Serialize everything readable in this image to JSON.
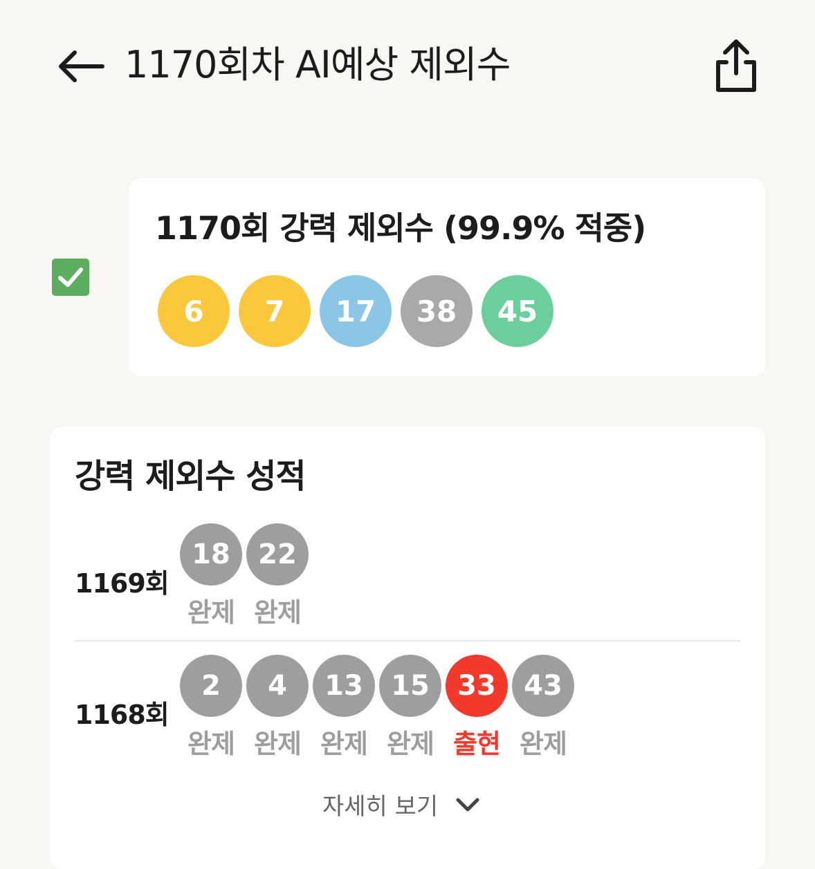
{
  "header": {
    "title": "1170회차 AI예상 제외수",
    "back_icon": "arrow-left-icon",
    "share_icon": "share-icon"
  },
  "prediction": {
    "checked": true,
    "title": "1170회 강력 제외수 (99.9% 적중)",
    "balls": [
      {
        "number": "6",
        "color": "#fbc73c"
      },
      {
        "number": "7",
        "color": "#fbc73c"
      },
      {
        "number": "17",
        "color": "#8cc6e6"
      },
      {
        "number": "38",
        "color": "#a9a9a9"
      },
      {
        "number": "45",
        "color": "#6ccf9b"
      }
    ]
  },
  "record": {
    "title": "강력 제외수 성적",
    "rounds": [
      {
        "label": "1169회",
        "balls": [
          {
            "number": "18",
            "result": "완제",
            "hit": false
          },
          {
            "number": "22",
            "result": "완제",
            "hit": false
          }
        ]
      },
      {
        "label": "1168회",
        "balls": [
          {
            "number": "2",
            "result": "완제",
            "hit": false
          },
          {
            "number": "4",
            "result": "완제",
            "hit": false
          },
          {
            "number": "13",
            "result": "완제",
            "hit": false
          },
          {
            "number": "15",
            "result": "완제",
            "hit": false
          },
          {
            "number": "33",
            "result": "출현",
            "hit": true
          },
          {
            "number": "43",
            "result": "완제",
            "hit": false
          }
        ]
      }
    ],
    "more_label": "자세히 보기",
    "more_icon": "chevron-down-icon"
  },
  "colors": {
    "miss_ball": "#9e9e9e",
    "hit_ball": "#f23a2c",
    "check_green": "#5cad5f",
    "background": "#f8f7f3"
  }
}
